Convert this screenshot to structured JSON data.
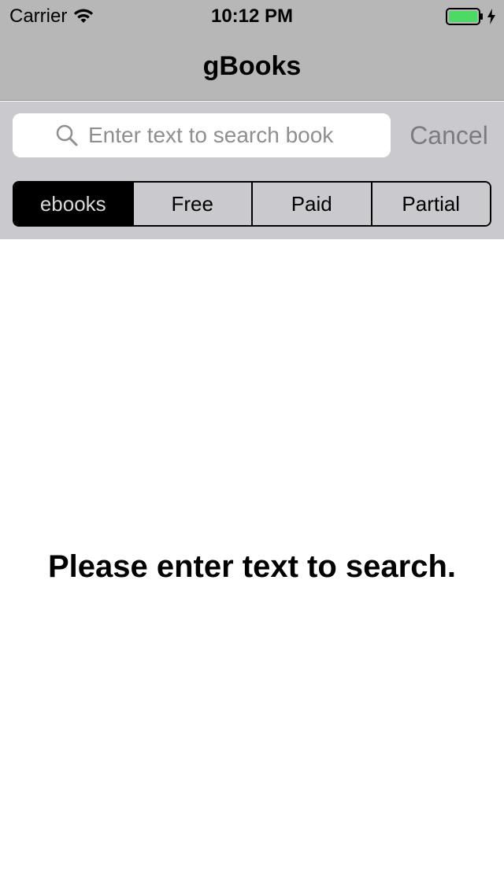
{
  "status_bar": {
    "carrier": "Carrier",
    "time": "10:12 PM",
    "battery_color": "#4cd964",
    "icons": [
      "wifi-icon",
      "battery-icon",
      "charging-bolt-icon"
    ]
  },
  "nav": {
    "title": "gBooks"
  },
  "search": {
    "placeholder": "Enter text to search book",
    "value": "",
    "cancel_label": "Cancel",
    "icon": "search-icon"
  },
  "segments": {
    "items": [
      {
        "label": "ebooks",
        "selected": true
      },
      {
        "label": "Free",
        "selected": false
      },
      {
        "label": "Paid",
        "selected": false
      },
      {
        "label": "Partial",
        "selected": false
      }
    ]
  },
  "content": {
    "empty_message": "Please enter text to search."
  },
  "colors": {
    "nav_background": "#b7b7b7",
    "search_background": "#c9c9ce",
    "selected_segment": "#000000"
  }
}
